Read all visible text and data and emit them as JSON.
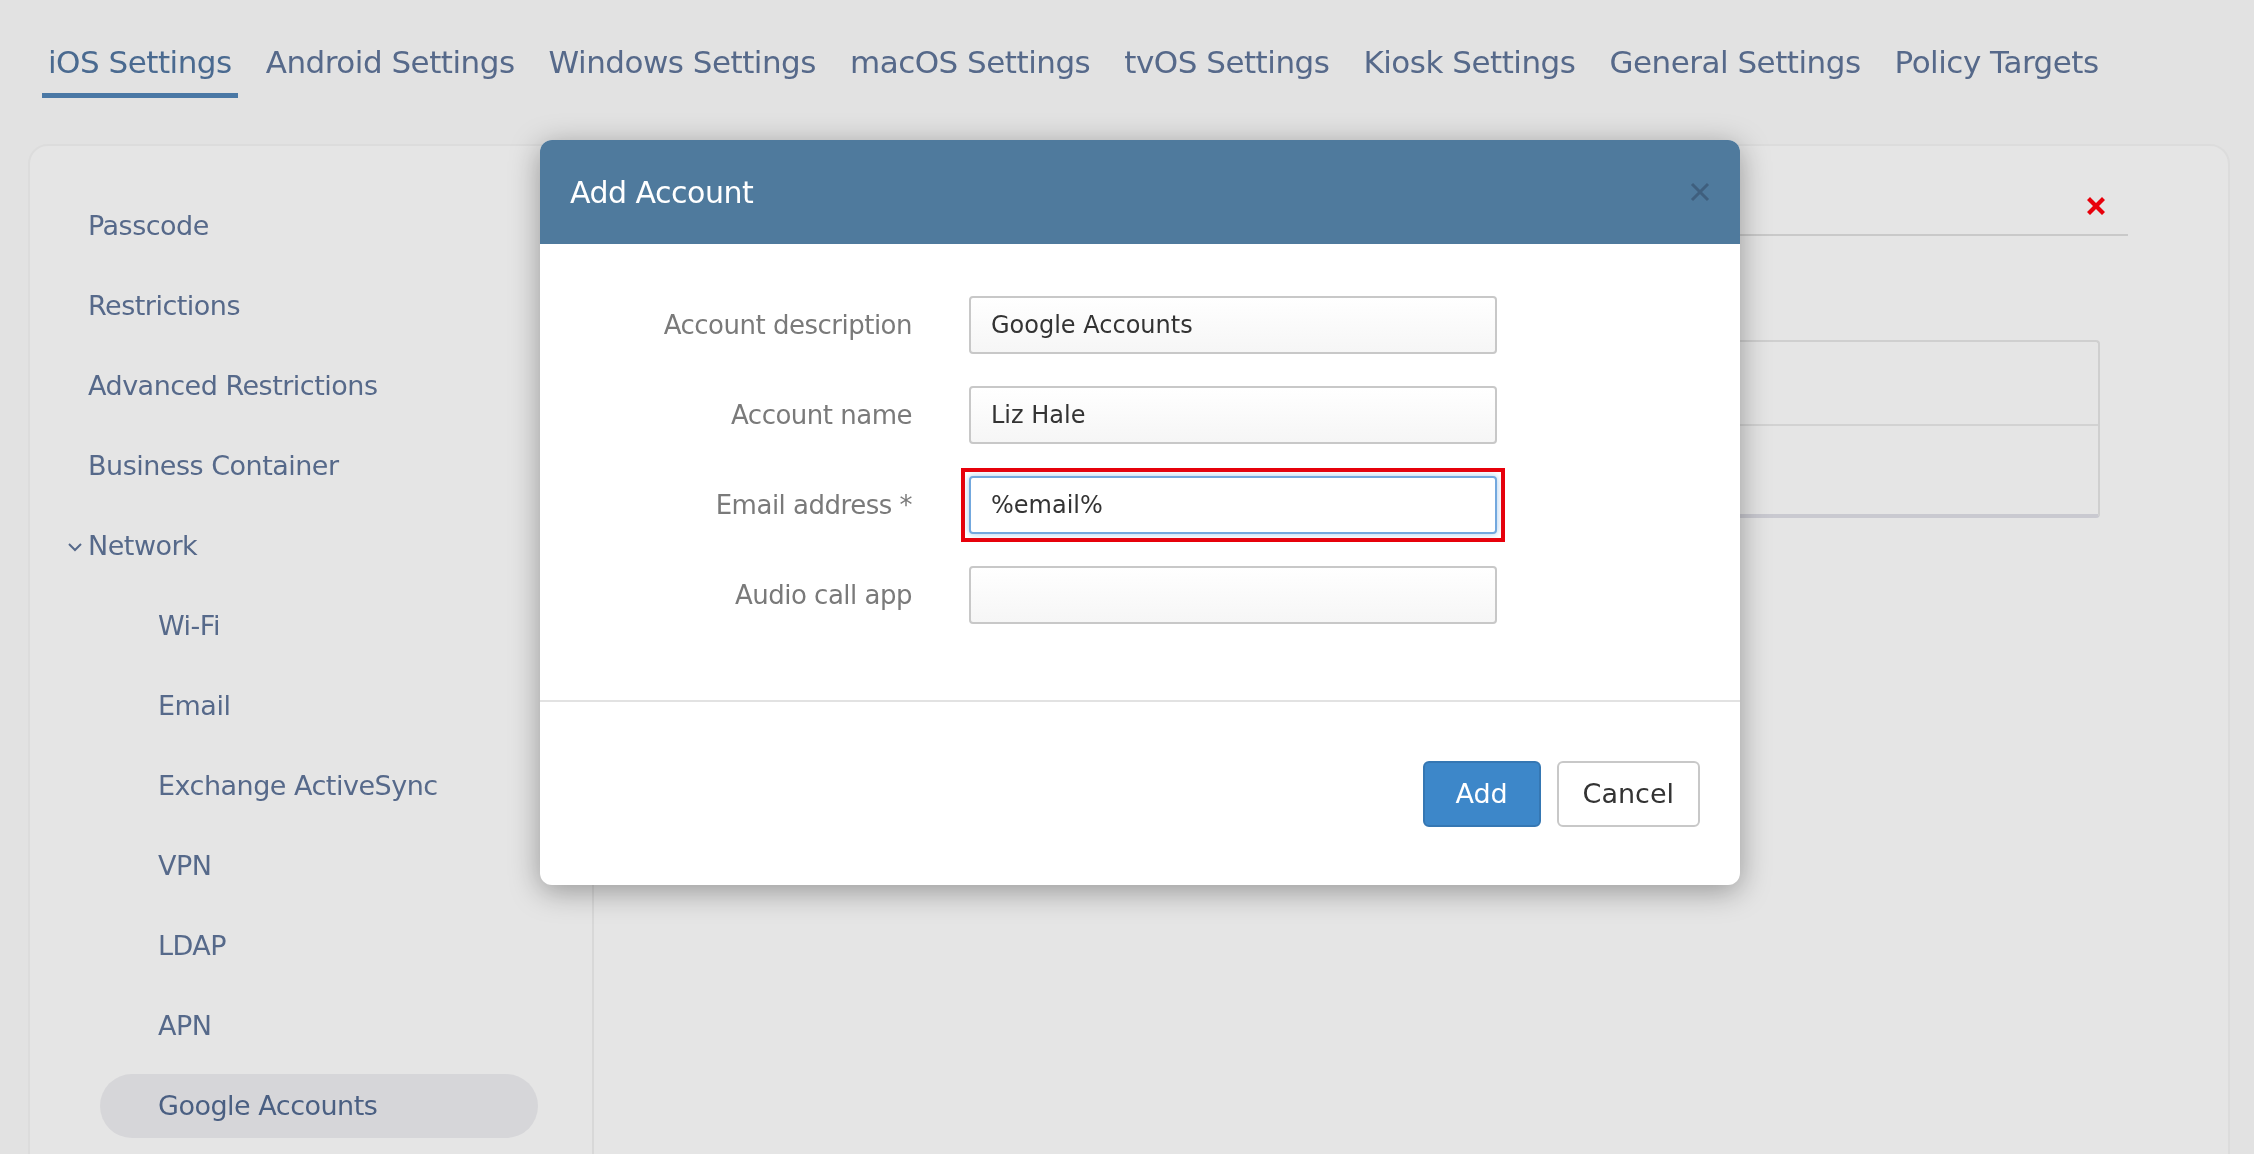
{
  "tabs": [
    {
      "label": "iOS Settings",
      "selected": true
    },
    {
      "label": "Android Settings",
      "selected": false
    },
    {
      "label": "Windows Settings",
      "selected": false
    },
    {
      "label": "macOS Settings",
      "selected": false
    },
    {
      "label": "tvOS Settings",
      "selected": false
    },
    {
      "label": "Kiosk Settings",
      "selected": false
    },
    {
      "label": "General Settings",
      "selected": false
    },
    {
      "label": "Policy Targets",
      "selected": false
    }
  ],
  "sidebar": {
    "items": [
      {
        "label": "Passcode",
        "selected": false
      },
      {
        "label": "Restrictions",
        "selected": false
      },
      {
        "label": "Advanced Restrictions",
        "selected": false
      },
      {
        "label": "Business Container",
        "selected": false
      },
      {
        "label": "Network",
        "selected": false,
        "expanded": true,
        "children": [
          {
            "label": "Wi-Fi",
            "selected": false
          },
          {
            "label": "Email",
            "selected": false
          },
          {
            "label": "Exchange ActiveSync",
            "selected": false
          },
          {
            "label": "VPN",
            "selected": false
          },
          {
            "label": "LDAP",
            "selected": false
          },
          {
            "label": "APN",
            "selected": false
          },
          {
            "label": "Google Accounts",
            "selected": true
          }
        ]
      }
    ]
  },
  "dialog": {
    "title": "Add Account",
    "fields": [
      {
        "label": "Account description",
        "value": "Google Accounts",
        "focused": false,
        "highlighted": false
      },
      {
        "label": "Account name",
        "value": "Liz Hale",
        "focused": false,
        "highlighted": false
      },
      {
        "label": "Email address *",
        "value": "%email%",
        "focused": true,
        "highlighted": true
      },
      {
        "label": "Audio call app",
        "focused": false,
        "highlighted": false
      }
    ],
    "buttons": [
      {
        "label": "Add",
        "kind": "primary"
      },
      {
        "label": "Cancel",
        "kind": "secondary"
      }
    ]
  }
}
